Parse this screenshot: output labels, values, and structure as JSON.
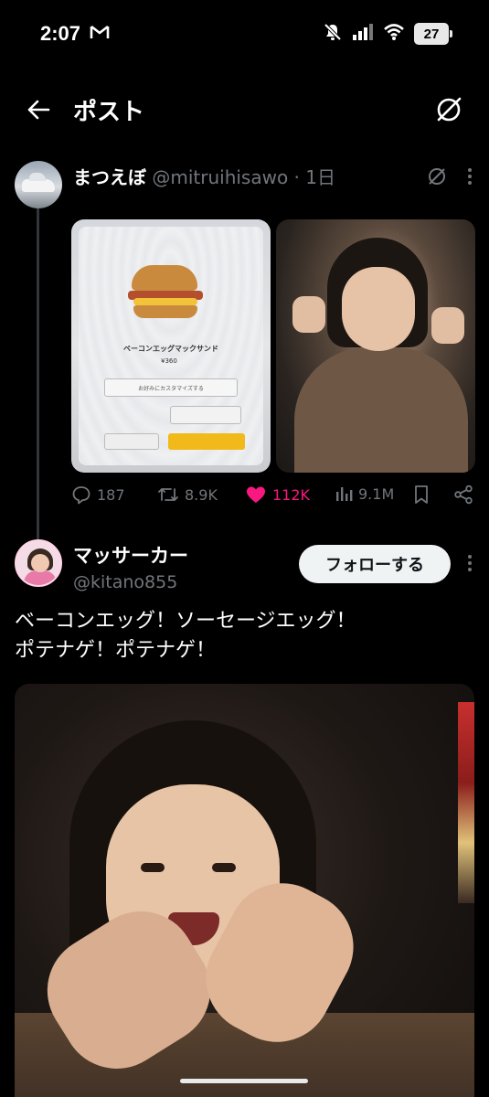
{
  "status_bar": {
    "time": "2:07",
    "battery": "27",
    "icons": [
      "gmail-icon",
      "mute-icon",
      "signal-icon",
      "wifi-icon",
      "battery-icon"
    ]
  },
  "header": {
    "title": "ポスト",
    "back_icon": "back-arrow-icon",
    "grok_icon": "grok-icon"
  },
  "parent_post": {
    "name": "まつえぼ",
    "handle": "@mitruihisawo",
    "separator": " · ",
    "time": "1日",
    "media": {
      "menu_item_name": "ベーコンエッグマックサンド",
      "menu_item_price": "¥360",
      "menu_field_text": "お好みにカスタマイズする"
    },
    "actions": {
      "replies": "187",
      "reposts": "8.9K",
      "likes": "112K",
      "views": "9.1M"
    },
    "colors": {
      "like": "#f91880",
      "muted": "#71767b"
    }
  },
  "reply_post": {
    "name": "マッサーカー",
    "handle": "@kitano855",
    "follow_label": "フォローする",
    "text": "ベーコンエッグ！ソーセージエッグ！\nポテナゲ！ポテナゲ！"
  }
}
